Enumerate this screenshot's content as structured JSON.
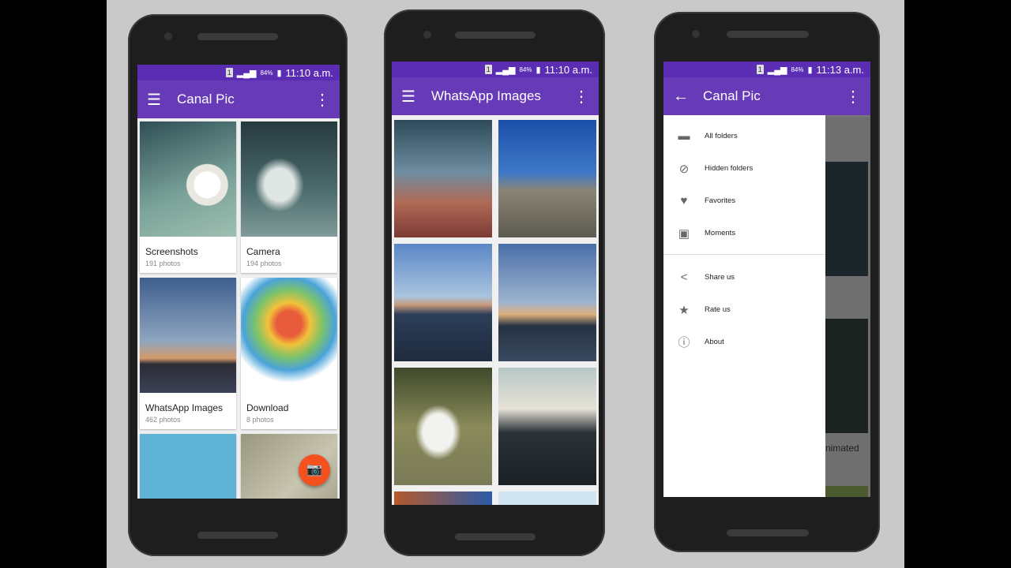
{
  "status": {
    "sim": "1",
    "battery": "84%"
  },
  "phone1": {
    "time": "11:10 a.m.",
    "title": "Canal Pic",
    "menu_icon": "hamburger-icon",
    "more_icon": "more-vert-icon",
    "albums": [
      {
        "name": "Screenshots",
        "count": "191 photos"
      },
      {
        "name": "Camera",
        "count": "194 photos"
      },
      {
        "name": "WhatsApp Images",
        "count": "462 photos"
      },
      {
        "name": "Download",
        "count": "8 photos"
      }
    ],
    "fab_icon": "camera-icon"
  },
  "phone2": {
    "time": "11:10 a.m.",
    "title": "WhatsApp Images"
  },
  "phone3": {
    "time": "11:13 a.m.",
    "title": "Canal Pic",
    "back_icon": "arrow-back-icon",
    "drawer": [
      {
        "label": "All folders",
        "icon": "folder-icon"
      },
      {
        "label": "Hidden folders",
        "icon": "eye-off-icon"
      },
      {
        "label": "Favorites",
        "icon": "heart-icon"
      },
      {
        "label": "Moments",
        "icon": "calendar-icon"
      },
      {
        "label": "Share us",
        "icon": "share-icon"
      },
      {
        "label": "Rate us",
        "icon": "star-icon"
      },
      {
        "label": "About",
        "icon": "info-icon"
      }
    ],
    "behind_text": "nimated"
  },
  "colors": {
    "primary": "#673ab7",
    "status": "#5b2db3",
    "fab": "#f4511e"
  }
}
